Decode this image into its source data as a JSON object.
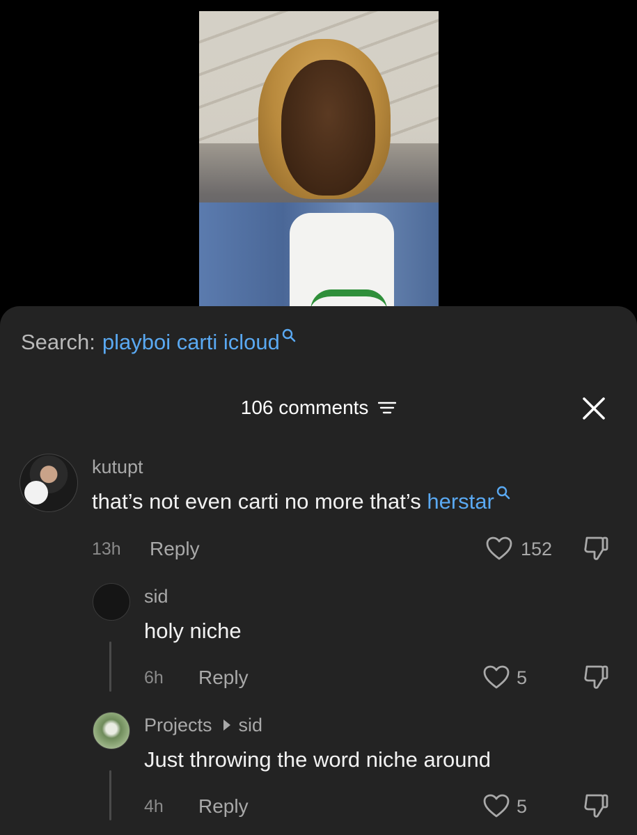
{
  "search": {
    "prefix": "Search:",
    "term": "playboi carti icloud"
  },
  "comments_panel": {
    "count_label": "106 comments"
  },
  "comments": [
    {
      "username": "kutupt",
      "text_plain": "that’s not even carti no more that’s ",
      "text_link": "herstar",
      "time": "13h",
      "reply_label": "Reply",
      "likes": "152"
    },
    {
      "username": "sid",
      "text": "holy niche",
      "time": "6h",
      "reply_label": "Reply",
      "likes": "5"
    },
    {
      "username": "Projects",
      "reply_to": "sid",
      "text": "Just throwing the word niche around",
      "time": "4h",
      "reply_label": "Reply",
      "likes": "5"
    }
  ],
  "icons": {
    "search": "search-icon",
    "filter": "filter-icon",
    "close": "close-icon",
    "like": "heart-icon",
    "dislike": "thumbs-down-icon"
  },
  "colors": {
    "sheet_bg": "#232323",
    "link": "#5aa9f2",
    "muted": "#a9a9a9"
  }
}
